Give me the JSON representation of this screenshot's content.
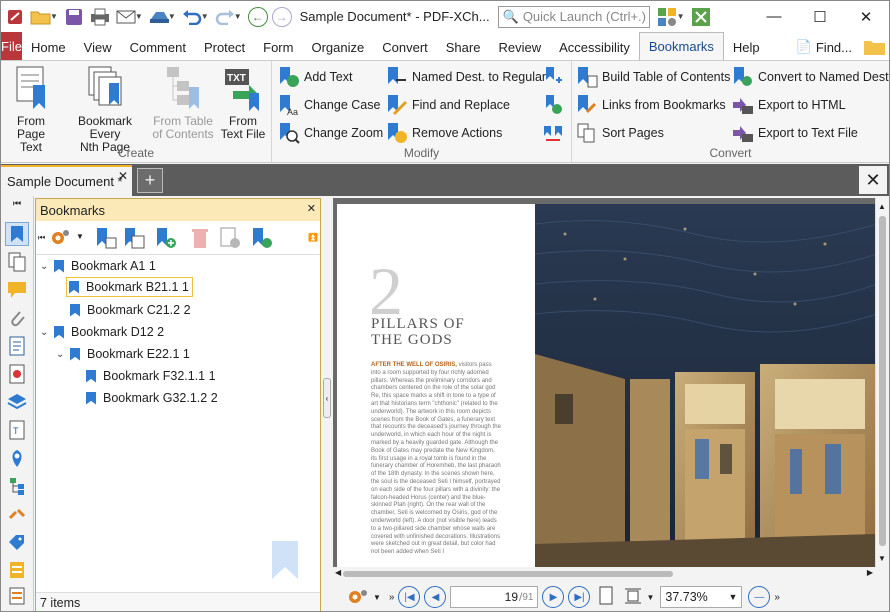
{
  "titlebar": {
    "doc_title": "Sample Document* - PDF-XCh...",
    "quick_launch_placeholder": "Quick Launch (Ctrl+.)"
  },
  "menu": {
    "file": "File",
    "tabs": [
      "Home",
      "View",
      "Comment",
      "Protect",
      "Form",
      "Organize",
      "Convert",
      "Share",
      "Review",
      "Accessibility",
      "Bookmarks",
      "Help"
    ],
    "active": "Bookmarks",
    "find": "Find..."
  },
  "ribbon": {
    "create": {
      "label": "Create",
      "from_page_text": "From\nPage Text",
      "every_nth": "Bookmark Every\nNth Page",
      "from_toc": "From Table\nof Contents",
      "from_text_file": "From\nText File"
    },
    "modify": {
      "label": "Modify",
      "add_text": "Add Text",
      "change_case": "Change Case",
      "change_zoom": "Change Zoom",
      "named_to_regular": "Named Dest. to Regular",
      "find_replace": "Find and Replace",
      "remove_actions": "Remove Actions"
    },
    "convert": {
      "label": "Convert",
      "build_toc": "Build Table of Contents",
      "links_from": "Links from Bookmarks",
      "sort_pages": "Sort Pages",
      "to_named": "Convert to Named Dest.",
      "export_html": "Export to HTML",
      "export_text": "Export to Text File"
    }
  },
  "doc_tab": {
    "label": "Sample Document *"
  },
  "panel": {
    "title": "Bookmarks",
    "items": [
      {
        "label": "Bookmark A1 1",
        "level": 0,
        "expanded": true
      },
      {
        "label": "Bookmark B21.1 1",
        "level": 1,
        "selected": true
      },
      {
        "label": "Bookmark C21.2 2",
        "level": 1
      },
      {
        "label": "Bookmark D12 2",
        "level": 0,
        "expanded": true
      },
      {
        "label": "Bookmark E22.1 1",
        "level": 1,
        "expanded": true
      },
      {
        "label": "Bookmark F32.1.1 1",
        "level": 2
      },
      {
        "label": "Bookmark G32.1.2 2",
        "level": 2
      }
    ],
    "count": "7 items"
  },
  "page_content": {
    "number": "2",
    "chapter": "PILLARS OF\nTHE GODS",
    "lead": "AFTER THE WELL OF OSIRIS,",
    "body": "visitors pass into a room supported by four richly adorned pillars. Whereas the preliminary corridors and chambers centered on the role of the solar god Re, this space marks a shift in tone to a type of art that historians term \"chthonic\" (related to the underworld). The artwork in this room depicts scenes from the Book of Gates, a funerary text that recounts the deceased's journey through the underworld, in which each hour of the night is marked by a heavily guarded gate. Although the Book of Gates may predate the New Kingdom, its first usage in a royal tomb is found in the funerary chamber of Horemheb, the last pharaoh of the 18th dynasty. In the scenes shown here, the soul is the deceased Seti I himself, portrayed on each side of the four pillars with a divinity: the falcon-headed Horus (center) and the blue-skinned Ptah (right). On the rear wall of the chamber, Seti is welcomed by Osiris, god of the underworld (left). A door (not visible here) leads to a two-pillared side chamber whose walls are covered with unfinished decorations. Illustrations were sketched out in great detail, but color had not been added when Seti I"
  },
  "status": {
    "page": "19",
    "total": "91",
    "zoom": "37.73%"
  }
}
